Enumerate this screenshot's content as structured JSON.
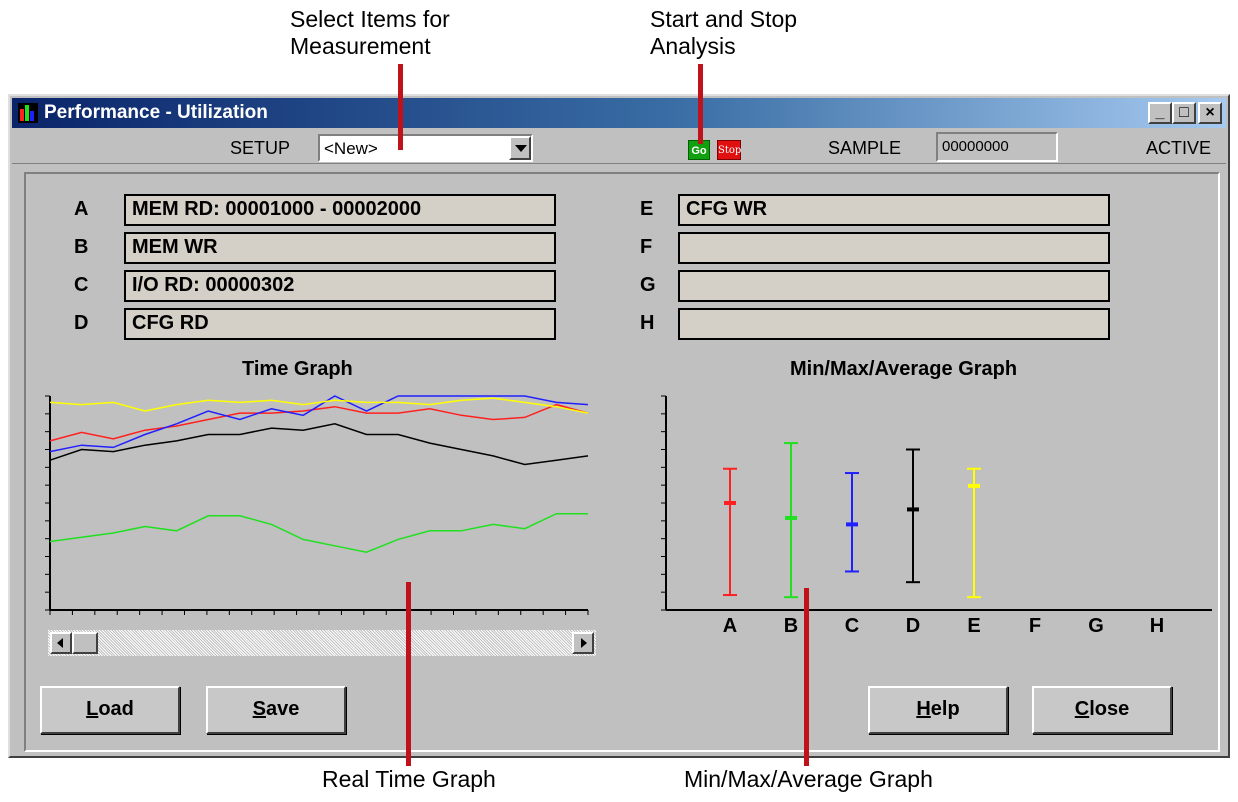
{
  "callouts": {
    "select_items_line1": "Select Items for",
    "select_items_line2": "Measurement",
    "start_stop_line1": "Start and Stop",
    "start_stop_line2": "Analysis",
    "real_time_graph": "Real Time Graph",
    "minmax_graph": "Min/Max/Average Graph"
  },
  "window": {
    "title": "Performance - Utilization",
    "minimize_glyph": "_",
    "maximize_glyph": "□",
    "close_glyph": "×"
  },
  "toolbar": {
    "setup_label": "SETUP",
    "setup_value": "<New>",
    "go_label": "Go",
    "stop_label": "Stop",
    "sample_label": "SAMPLE",
    "sample_value": "00000000",
    "status": "ACTIVE"
  },
  "measurements": {
    "left": [
      {
        "letter": "A",
        "value": "MEM RD: 00001000 - 00002000"
      },
      {
        "letter": "B",
        "value": "MEM WR"
      },
      {
        "letter": "C",
        "value": "I/O RD: 00000302"
      },
      {
        "letter": "D",
        "value": "CFG RD"
      }
    ],
    "right": [
      {
        "letter": "E",
        "value": "CFG WR"
      },
      {
        "letter": "F",
        "value": ""
      },
      {
        "letter": "G",
        "value": ""
      },
      {
        "letter": "H",
        "value": ""
      }
    ]
  },
  "graphs": {
    "time_graph_title": "Time Graph",
    "minmax_title": "Min/Max/Average Graph"
  },
  "buttons": {
    "load": {
      "mnemonic": "L",
      "rest": "oad"
    },
    "save": {
      "mnemonic": "S",
      "rest": "ave"
    },
    "help": {
      "mnemonic": "H",
      "rest": "elp"
    },
    "close": {
      "mnemonic": "C",
      "rest": "lose"
    }
  },
  "colors": {
    "A": "#ff2020",
    "B": "#20e020",
    "C": "#2020ff",
    "D": "#000000",
    "E": "#ffff00",
    "callout_line": "#c0121a"
  },
  "chart_data": [
    {
      "type": "line",
      "title": "Time Graph",
      "series": [
        {
          "name": "A",
          "values": [
            0.79,
            0.83,
            0.8,
            0.84,
            0.86,
            0.89,
            0.92,
            0.92,
            0.93,
            0.95,
            0.92,
            0.92,
            0.94,
            0.91,
            0.89,
            0.9,
            0.96,
            0.92
          ]
        },
        {
          "name": "B",
          "values": [
            0.32,
            0.34,
            0.36,
            0.39,
            0.37,
            0.44,
            0.44,
            0.4,
            0.33,
            0.3,
            0.27,
            0.33,
            0.37,
            0.37,
            0.4,
            0.38,
            0.45,
            0.45
          ]
        },
        {
          "name": "C",
          "values": [
            0.74,
            0.77,
            0.76,
            0.82,
            0.87,
            0.93,
            0.89,
            0.94,
            0.91,
            1.0,
            0.93,
            1.0,
            1.0,
            1.0,
            1.0,
            1.0,
            0.97,
            0.96
          ]
        },
        {
          "name": "D",
          "values": [
            0.7,
            0.75,
            0.74,
            0.77,
            0.79,
            0.82,
            0.82,
            0.85,
            0.84,
            0.87,
            0.82,
            0.82,
            0.78,
            0.75,
            0.72,
            0.68,
            0.7,
            0.72
          ]
        },
        {
          "name": "E",
          "values": [
            0.97,
            0.96,
            0.97,
            0.93,
            0.96,
            0.98,
            0.97,
            0.98,
            0.96,
            0.98,
            0.97,
            0.97,
            0.96,
            0.98,
            0.99,
            0.97,
            0.95,
            0.92
          ]
        }
      ]
    },
    {
      "type": "bar",
      "title": "Min/Max/Average Graph",
      "categories": [
        "A",
        "B",
        "C",
        "D",
        "E",
        "F",
        "G",
        "H"
      ],
      "series": [
        {
          "name": "min",
          "values": [
            0.07,
            0.06,
            0.18,
            0.13,
            0.06,
            null,
            null,
            null
          ]
        },
        {
          "name": "max",
          "values": [
            0.66,
            0.78,
            0.64,
            0.75,
            0.66,
            null,
            null,
            null
          ]
        },
        {
          "name": "avg",
          "values": [
            0.5,
            0.43,
            0.4,
            0.47,
            0.58,
            null,
            null,
            null
          ]
        }
      ]
    }
  ]
}
